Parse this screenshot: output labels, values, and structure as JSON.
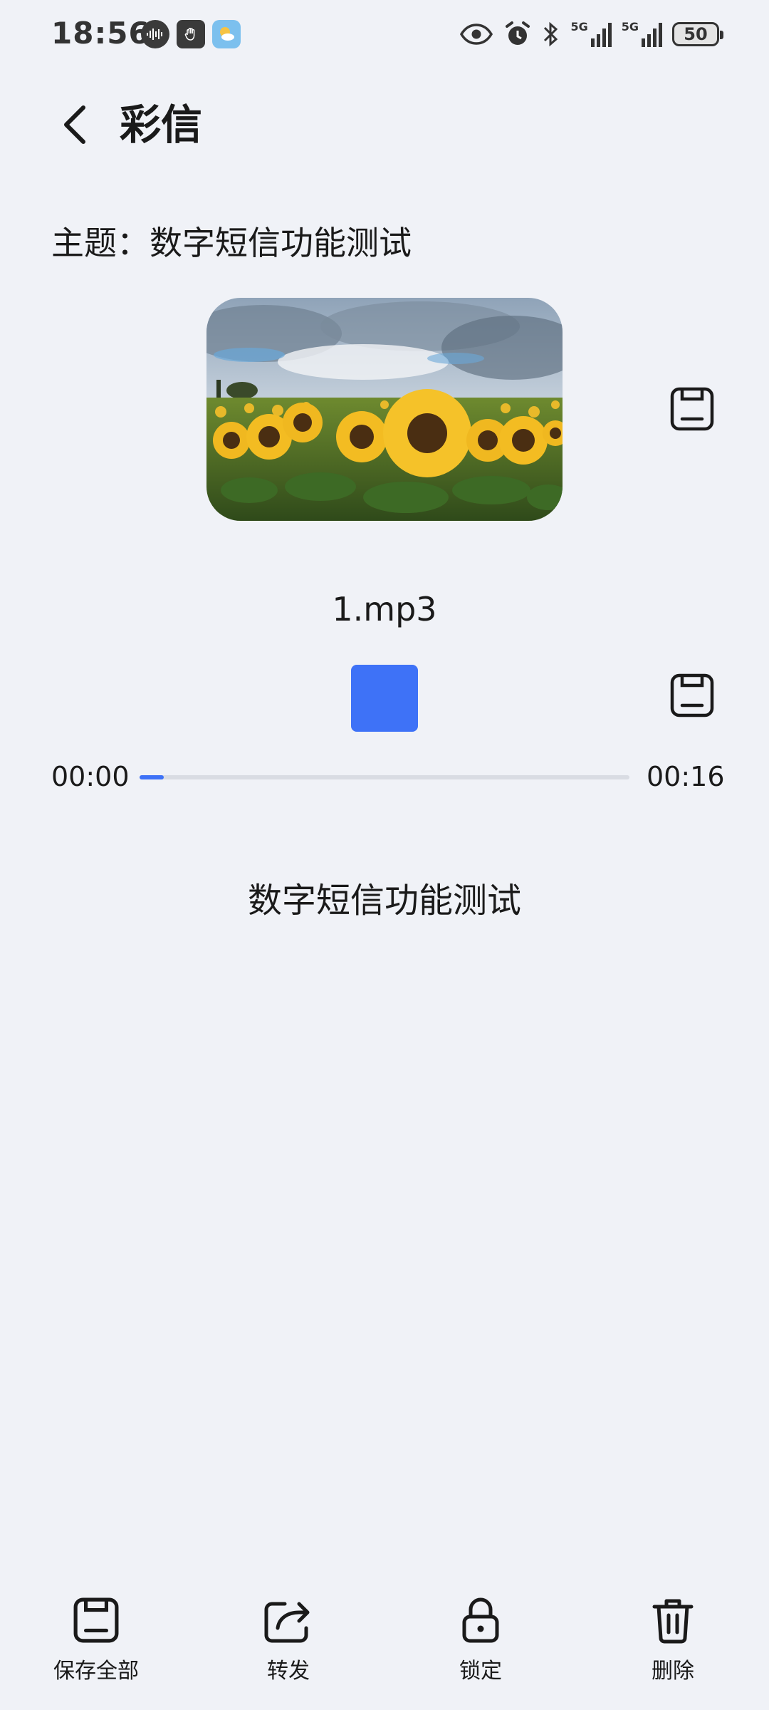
{
  "status_bar": {
    "time": "18:56",
    "network_1": "5G",
    "network_2": "5G",
    "battery": "50"
  },
  "header": {
    "title": "彩信"
  },
  "subject": {
    "text": "主题：数字短信功能测试"
  },
  "image": {
    "description_icon": "sunflower-field-image"
  },
  "audio": {
    "filename": "1.mp3",
    "current_time": "00:00",
    "total_time": "00:16",
    "progress": 0.05
  },
  "message": {
    "body": "数字短信功能测试"
  },
  "toolbar": {
    "save_all": "保存全部",
    "forward": "转发",
    "lock": "锁定",
    "delete": "删除"
  },
  "colors": {
    "background": "#f0f2f7",
    "accent": "#3e72f7",
    "text": "#1a1a1a"
  }
}
